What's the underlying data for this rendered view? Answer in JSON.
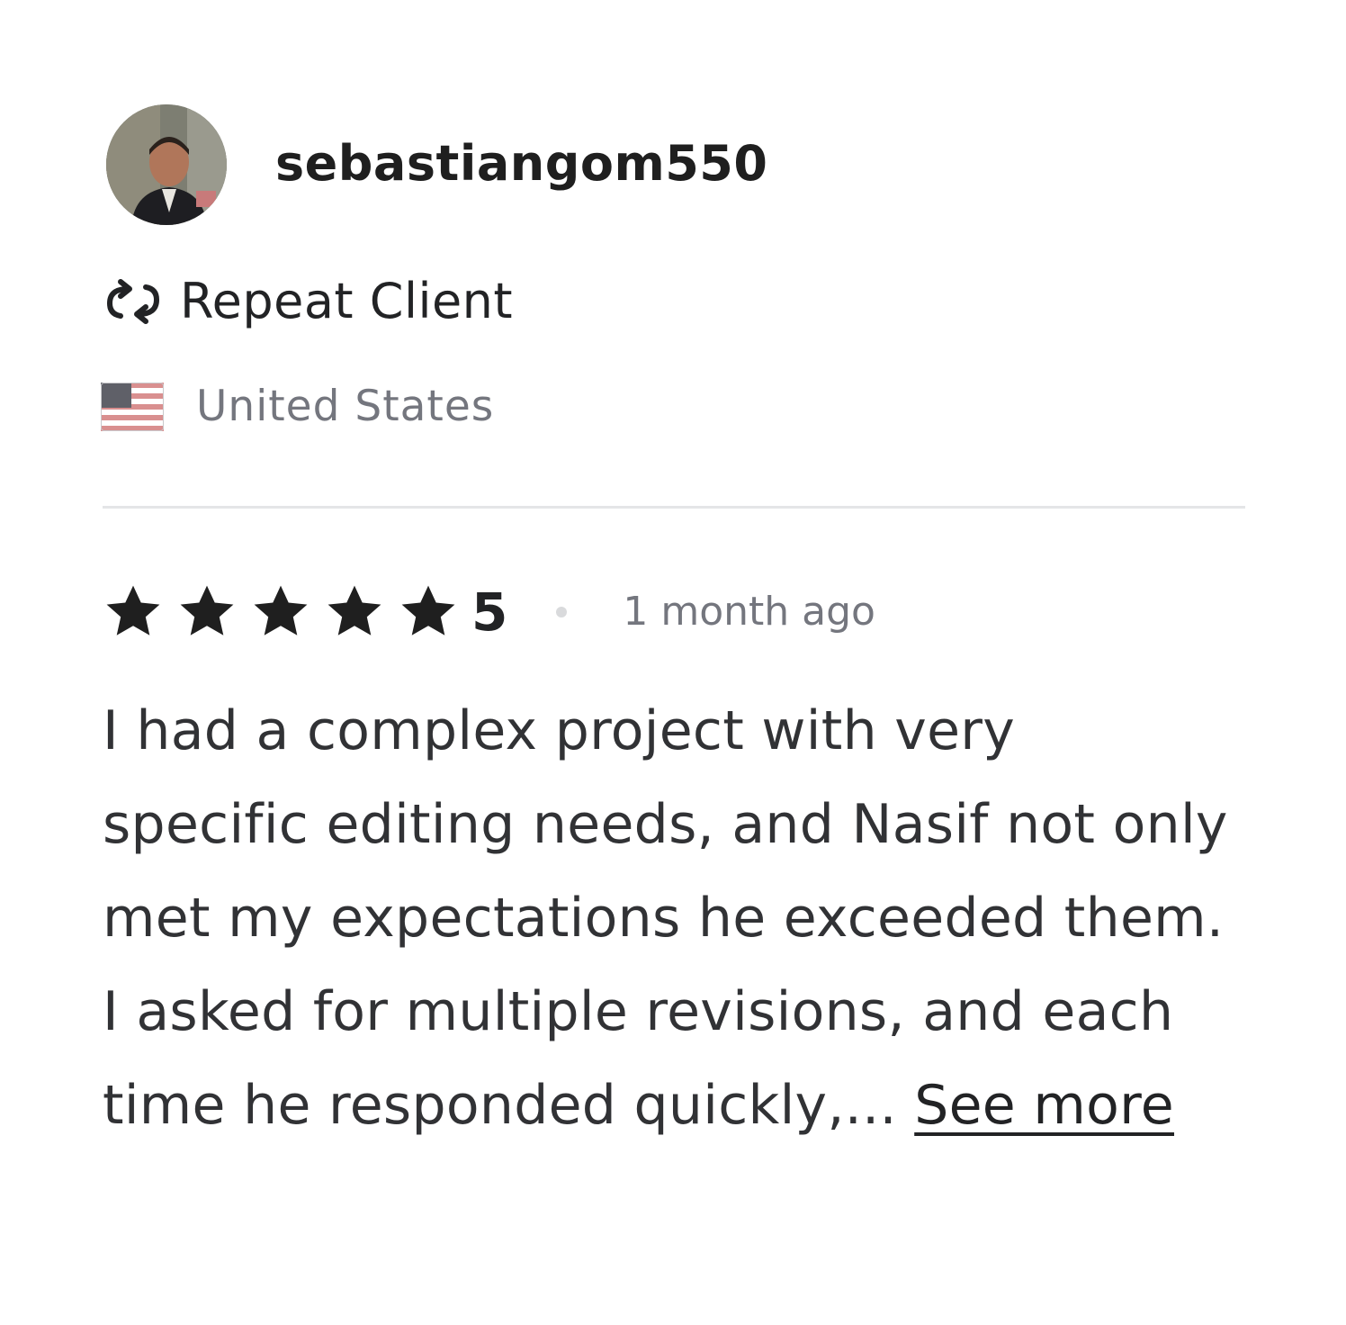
{
  "reviewer": {
    "username": "sebastiangom550",
    "badge_label": "Repeat Client",
    "badge_icon": "repeat-icon",
    "country": "United States",
    "country_flag_icon": "us-flag-icon"
  },
  "review": {
    "star_count": 5,
    "rating": "5",
    "time": "1 month ago",
    "text": "I had a complex project with very specific editing needs, and Nasif not only met my expectations he exceeded them. I asked for multiple revisions, and each time he responded quickly,... ",
    "see_more_label": "See more"
  },
  "colors": {
    "text": "#222325",
    "muted": "#74767e",
    "divider": "#e4e5e7"
  }
}
